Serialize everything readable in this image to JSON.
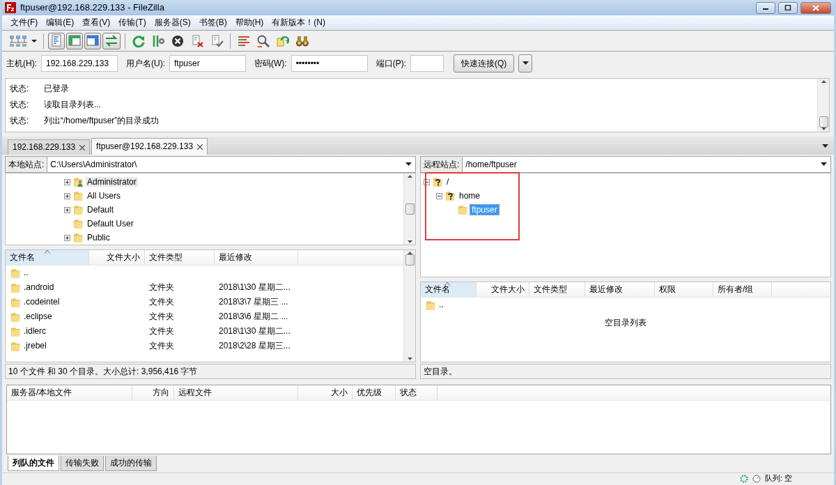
{
  "window": {
    "title": "ftpuser@192.168.229.133 - FileZilla"
  },
  "menu": [
    "文件(F)",
    "编辑(E)",
    "查看(V)",
    "传输(T)",
    "服务器(S)",
    "书签(B)",
    "帮助(H)",
    "有新版本！(N)"
  ],
  "toolbar": [
    {
      "pressed": false
    },
    {
      "pressed": true
    },
    {
      "pressed": true
    },
    {
      "pressed": true
    },
    {
      "pressed": true
    },
    {
      "pressed": false
    },
    {
      "pressed": false
    },
    {
      "pressed": false
    },
    {
      "pressed": false
    },
    {
      "pressed": false
    },
    {
      "pressed": false
    },
    {
      "pressed": false
    },
    {
      "pressed": false
    },
    {
      "pressed": false
    }
  ],
  "quickconnect": {
    "host_label": "主机(H):",
    "host": "192.168.229.133",
    "user_label": "用户名(U):",
    "user": "ftpuser",
    "password_label": "密码(W):",
    "password": "••••••••",
    "port_label": "端口(P):",
    "connect_button": "快速连接(Q)"
  },
  "log": [
    {
      "label": "状态:",
      "message": "已登录"
    },
    {
      "label": "状态:",
      "message": "读取目录列表..."
    },
    {
      "label": "状态:",
      "message": "列出“/home/ftpuser”的目录成功"
    }
  ],
  "tabs": [
    {
      "label": "192.168.229.133",
      "selected": false
    },
    {
      "label": "ftpuser@192.168.229.133",
      "selected": true
    }
  ],
  "local": {
    "site_label": "本地站点:",
    "path": "C:\\Users\\Administrator\\",
    "tree": [
      {
        "label": "Administrator",
        "kind": "user",
        "expandable": true,
        "expanded": false,
        "selected": true
      },
      {
        "label": "All Users",
        "kind": "folder",
        "expandable": true,
        "expanded": false,
        "selected": false
      },
      {
        "label": "Default",
        "kind": "folder",
        "expandable": true,
        "expanded": false,
        "selected": false
      },
      {
        "label": "Default User",
        "kind": "folder",
        "expandable": false,
        "selected": false
      },
      {
        "label": "Public",
        "kind": "folder",
        "expandable": true,
        "expanded": false,
        "selected": false
      }
    ],
    "columns": [
      "文件名",
      "文件大小",
      "文件类型",
      "最近修改"
    ],
    "rows": [
      {
        "name": ".."
      },
      {
        "name": ".android",
        "type": "文件夹",
        "modified": "2018\\1\\30 星期二..."
      },
      {
        "name": ".codeintel",
        "type": "文件夹",
        "modified": "2018\\3\\7 星期三 ..."
      },
      {
        "name": ".eclipse",
        "type": "文件夹",
        "modified": "2018\\3\\6 星期二 ..."
      },
      {
        "name": ".idlerc",
        "type": "文件夹",
        "modified": "2018\\1\\30 星期二..."
      },
      {
        "name": ".jrebel",
        "type": "文件夹",
        "modified": "2018\\2\\28 星期三..."
      }
    ],
    "status": "10 个文件 和 30 个目录。大小总计: 3,956,416 字节"
  },
  "remote": {
    "site_label": "远程站点:",
    "path": "/home/ftpuser",
    "tree": [
      {
        "label": "/",
        "kind": "unknown",
        "expandable": true,
        "expanded": true,
        "selected": false,
        "children": [
          {
            "label": "home",
            "kind": "unknown",
            "expandable": true,
            "expanded": true,
            "selected": false,
            "children": [
              {
                "label": "ftpuser",
                "kind": "folder",
                "expandable": false,
                "selected": true
              }
            ]
          }
        ]
      }
    ],
    "columns": [
      "文件名",
      "文件大小",
      "文件类型",
      "最近修改",
      "权限",
      "所有者/组"
    ],
    "rows": [
      {
        "name": ".."
      }
    ],
    "empty_message": "空目录列表",
    "status": "空目录。"
  },
  "queue": {
    "columns": [
      "服务器/本地文件",
      "方向",
      "远程文件",
      "大小",
      "优先级",
      "状态"
    ],
    "tabs": [
      {
        "label": "列队的文件",
        "selected": true
      },
      {
        "label": "传输失败",
        "selected": false
      },
      {
        "label": "成功的传输",
        "selected": false
      }
    ]
  },
  "status_bar": {
    "queue": "队列: 空"
  }
}
